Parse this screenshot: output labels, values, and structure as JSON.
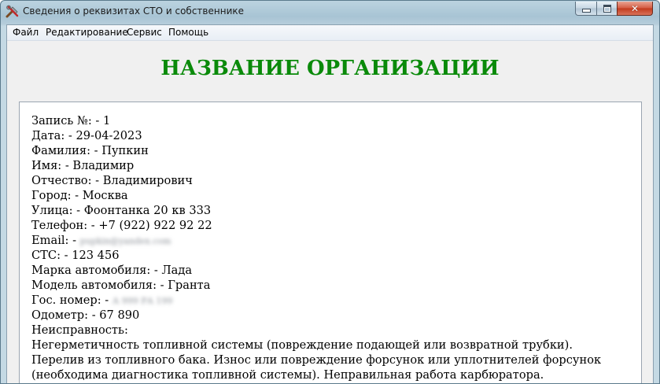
{
  "window": {
    "title": "Сведения о реквизитах СТО и собственнике",
    "icon": "tools-icon",
    "close_glyph": "✕"
  },
  "menu": {
    "items": [
      "Файл",
      "Редактирование",
      "Сервис",
      "Помощь"
    ]
  },
  "org_title": "НАЗВАНИЕ ОРГАНИЗАЦИИ",
  "record": {
    "number": "Запись №: - 1",
    "date": "Дата: - 29-04-2023",
    "last_name": "Фамилия: - Пупкин",
    "first_name": "Имя: - Владимир",
    "patronymic": "Отчество: - Владимирович",
    "city": "Город: - Москва",
    "street": "Улица: - Фоонтанка 20 кв 333",
    "phone": "Телефон: - +7 (922) 922 92 22",
    "email_label": "Email: - ",
    "email_value": "pupkin@yandex.com",
    "sts": "СТС: - 123 456",
    "car_brand": "Марка автомобиля: - Лада",
    "car_model": "Модель автомобиля: - Гранта",
    "plate_label": "Гос. номер: - ",
    "plate_value": "А 999 РА 199",
    "odometer": "Одометр: - 67 890",
    "fault_label": "Неисправность:",
    "fault_text": "Негерметичность топливной системы (повреждение подающей или возвратной трубки). Перелив из топливного бака. Износ или повреждение форсунок или уплотнителей форсунок (необходима диагностика топливной системы). Неправильная работа карбюратора."
  },
  "colors": {
    "org_title": "#0a8a0a",
    "close_button": "#c2391c",
    "client_bg": "#f0f0f0"
  }
}
